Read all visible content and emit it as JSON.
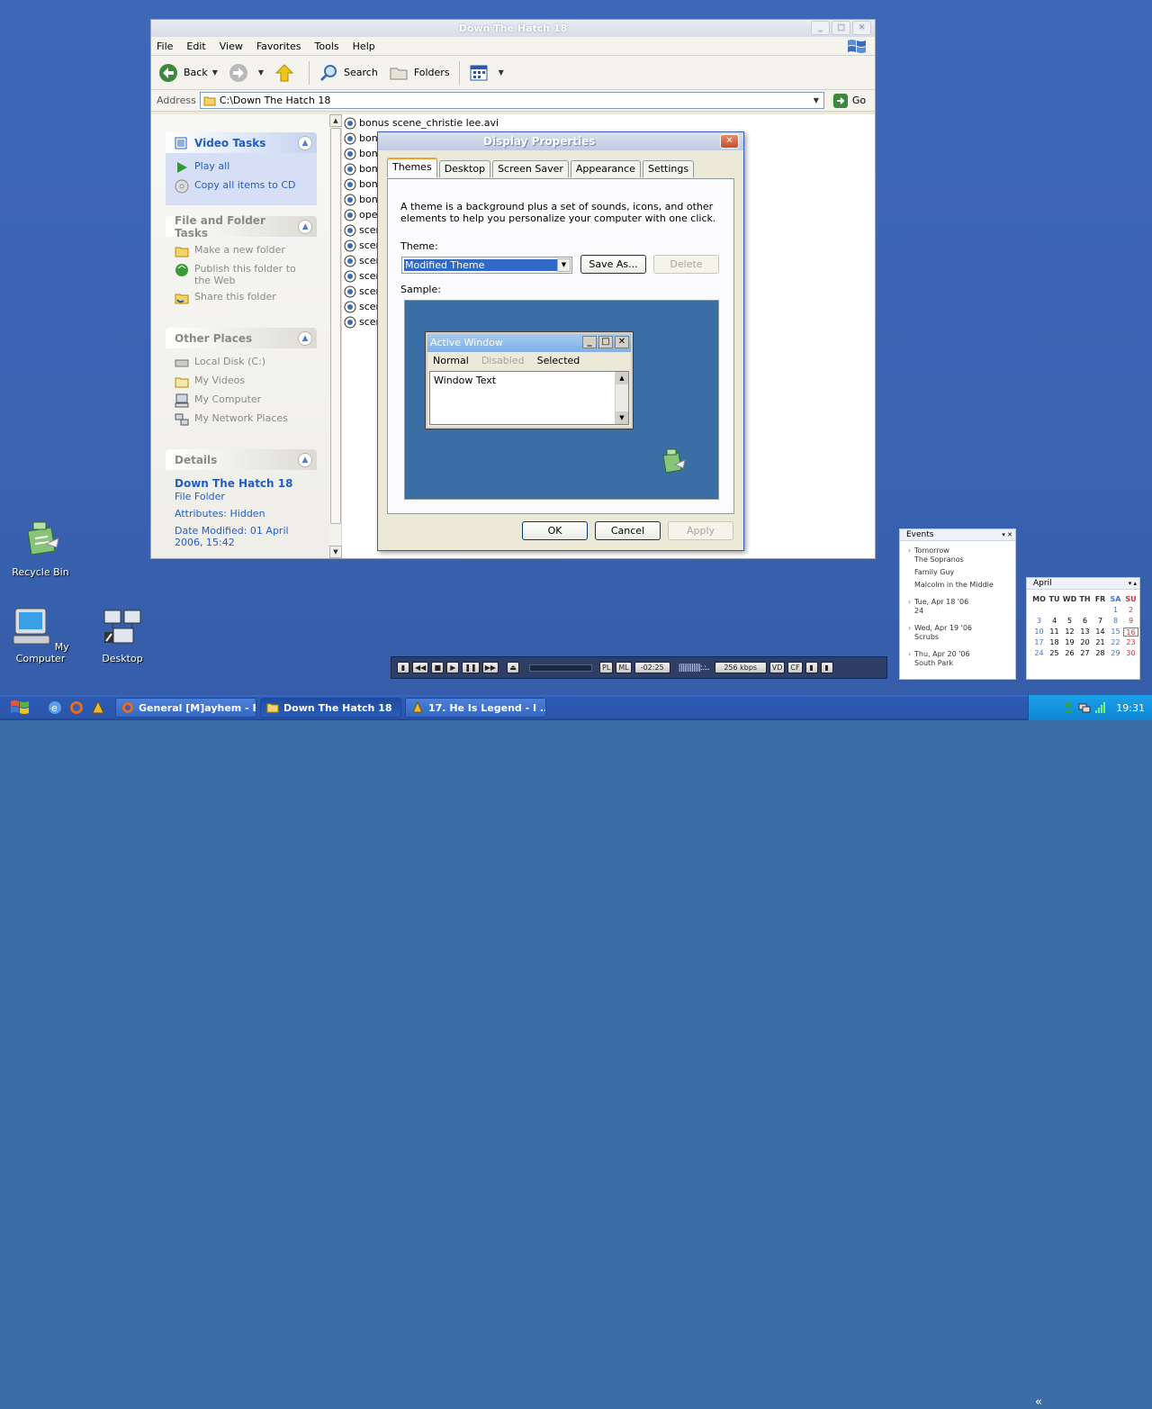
{
  "desktop_icons": [
    {
      "label": "Recycle Bin",
      "icon": "recycle-bin-icon"
    },
    {
      "label": "My Computer",
      "icon": "my-computer-icon"
    },
    {
      "label": "Desktop",
      "icon": "desktop-network-icon"
    }
  ],
  "explorer": {
    "title": "Down The Hatch 18",
    "menu": [
      "File",
      "Edit",
      "View",
      "Favorites",
      "Tools",
      "Help"
    ],
    "toolbar": {
      "back": "Back",
      "search": "Search",
      "folders": "Folders"
    },
    "address_label": "Address",
    "address_value": "C:\\Down The Hatch 18",
    "go_label": "Go",
    "panels": {
      "video_tasks": {
        "title": "Video Tasks",
        "items": [
          "Play all",
          "Copy all items to CD"
        ]
      },
      "file_folder_tasks": {
        "title": "File and Folder Tasks",
        "items": [
          "Make a new folder",
          "Publish this folder to the Web",
          "Share this folder"
        ]
      },
      "other_places": {
        "title": "Other Places",
        "items": [
          "Local Disk (C:)",
          "My Videos",
          "My Computer",
          "My Network Places"
        ]
      },
      "details": {
        "title": "Details",
        "name": "Down The Hatch 18",
        "type": "File Folder",
        "attributes": "Attributes: Hidden",
        "modified": "Date Modified: 01 April 2006, 15:42"
      }
    },
    "files": [
      "bonus scene_christie lee.avi",
      "bonus scene_jeanie marie sullivan.avi",
      "bonu",
      "bonu",
      "bonu",
      "bonu",
      "open",
      "scen",
      "scen",
      "scen",
      "scen",
      "scen",
      "scen",
      "scen"
    ]
  },
  "dialog": {
    "title": "Display Properties",
    "tabs": [
      "Themes",
      "Desktop",
      "Screen Saver",
      "Appearance",
      "Settings"
    ],
    "description": "A theme is a background plus a set of sounds, icons, and other elements to help you personalize your computer with one click.",
    "theme_label": "Theme:",
    "theme_value": "Modified Theme",
    "save_as": "Save As...",
    "delete": "Delete",
    "sample_label": "Sample:",
    "sample_window": {
      "title": "Active Window",
      "menu": [
        "Normal",
        "Disabled",
        "Selected"
      ],
      "text": "Window Text"
    },
    "ok": "OK",
    "cancel": "Cancel",
    "apply": "Apply"
  },
  "player": {
    "pl": "PL",
    "ml": "ML",
    "time": "-02:25",
    "bitrate": "256 kbps",
    "vd": "VD",
    "cf": "CF"
  },
  "events": {
    "title": "Events",
    "groups": [
      {
        "date": "Tomorrow",
        "items": [
          "The Sopranos",
          "Family Guy",
          "Malcolm in the Middle"
        ]
      },
      {
        "date": "Tue, Apr 18 '06",
        "items": [
          "24"
        ]
      },
      {
        "date": "Wed, Apr 19 '06",
        "items": [
          "Scrubs"
        ]
      },
      {
        "date": "Thu, Apr 20 '06",
        "items": [
          "South Park"
        ]
      }
    ]
  },
  "calendar": {
    "month": "April",
    "headers": [
      "MO",
      "TU",
      "WD",
      "TH",
      "FR",
      "SA",
      "SU"
    ],
    "weeks": [
      [
        "",
        "",
        "",
        "",
        "",
        "1",
        "2"
      ],
      [
        "3",
        "4",
        "5",
        "6",
        "7",
        "8",
        "9"
      ],
      [
        "10",
        "11",
        "12",
        "13",
        "14",
        "15",
        "16"
      ],
      [
        "17",
        "18",
        "19",
        "20",
        "21",
        "22",
        "23"
      ],
      [
        "24",
        "25",
        "26",
        "27",
        "28",
        "29",
        "30"
      ]
    ],
    "today": "16"
  },
  "taskbar": {
    "buttons": [
      "General [M]ayhem - E...",
      "Down The Hatch 18",
      "17. He Is Legend - I ..."
    ],
    "clock": "19:31"
  },
  "colors": {
    "accent": "#215dc6",
    "desktop": "#3a63b2",
    "taskbar": "#2a56ab",
    "tray": "#0f86d4"
  }
}
